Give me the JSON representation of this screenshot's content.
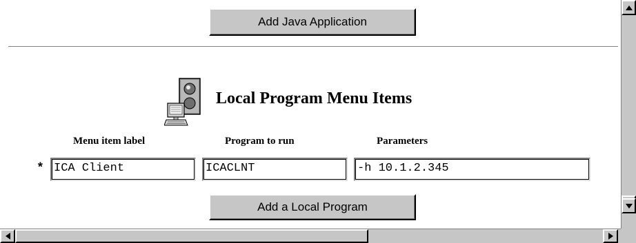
{
  "actions": {
    "add_java_label": "Add Java Application",
    "add_local_label": "Add a Local Program"
  },
  "section": {
    "title": "Local Program Menu Items",
    "icon": "terminal-traffic-light-icon"
  },
  "table": {
    "columns": [
      "Menu item label",
      "Program to run",
      "Parameters"
    ],
    "required_marker": "*",
    "row": {
      "menu_item_label": "ICA Client",
      "program_to_run": "ICACLNT",
      "parameters": "-h 10.1.2.345"
    }
  },
  "colors": {
    "background": "#ffffff",
    "button_face": "#c6c6c6",
    "shadow": "#808080"
  }
}
